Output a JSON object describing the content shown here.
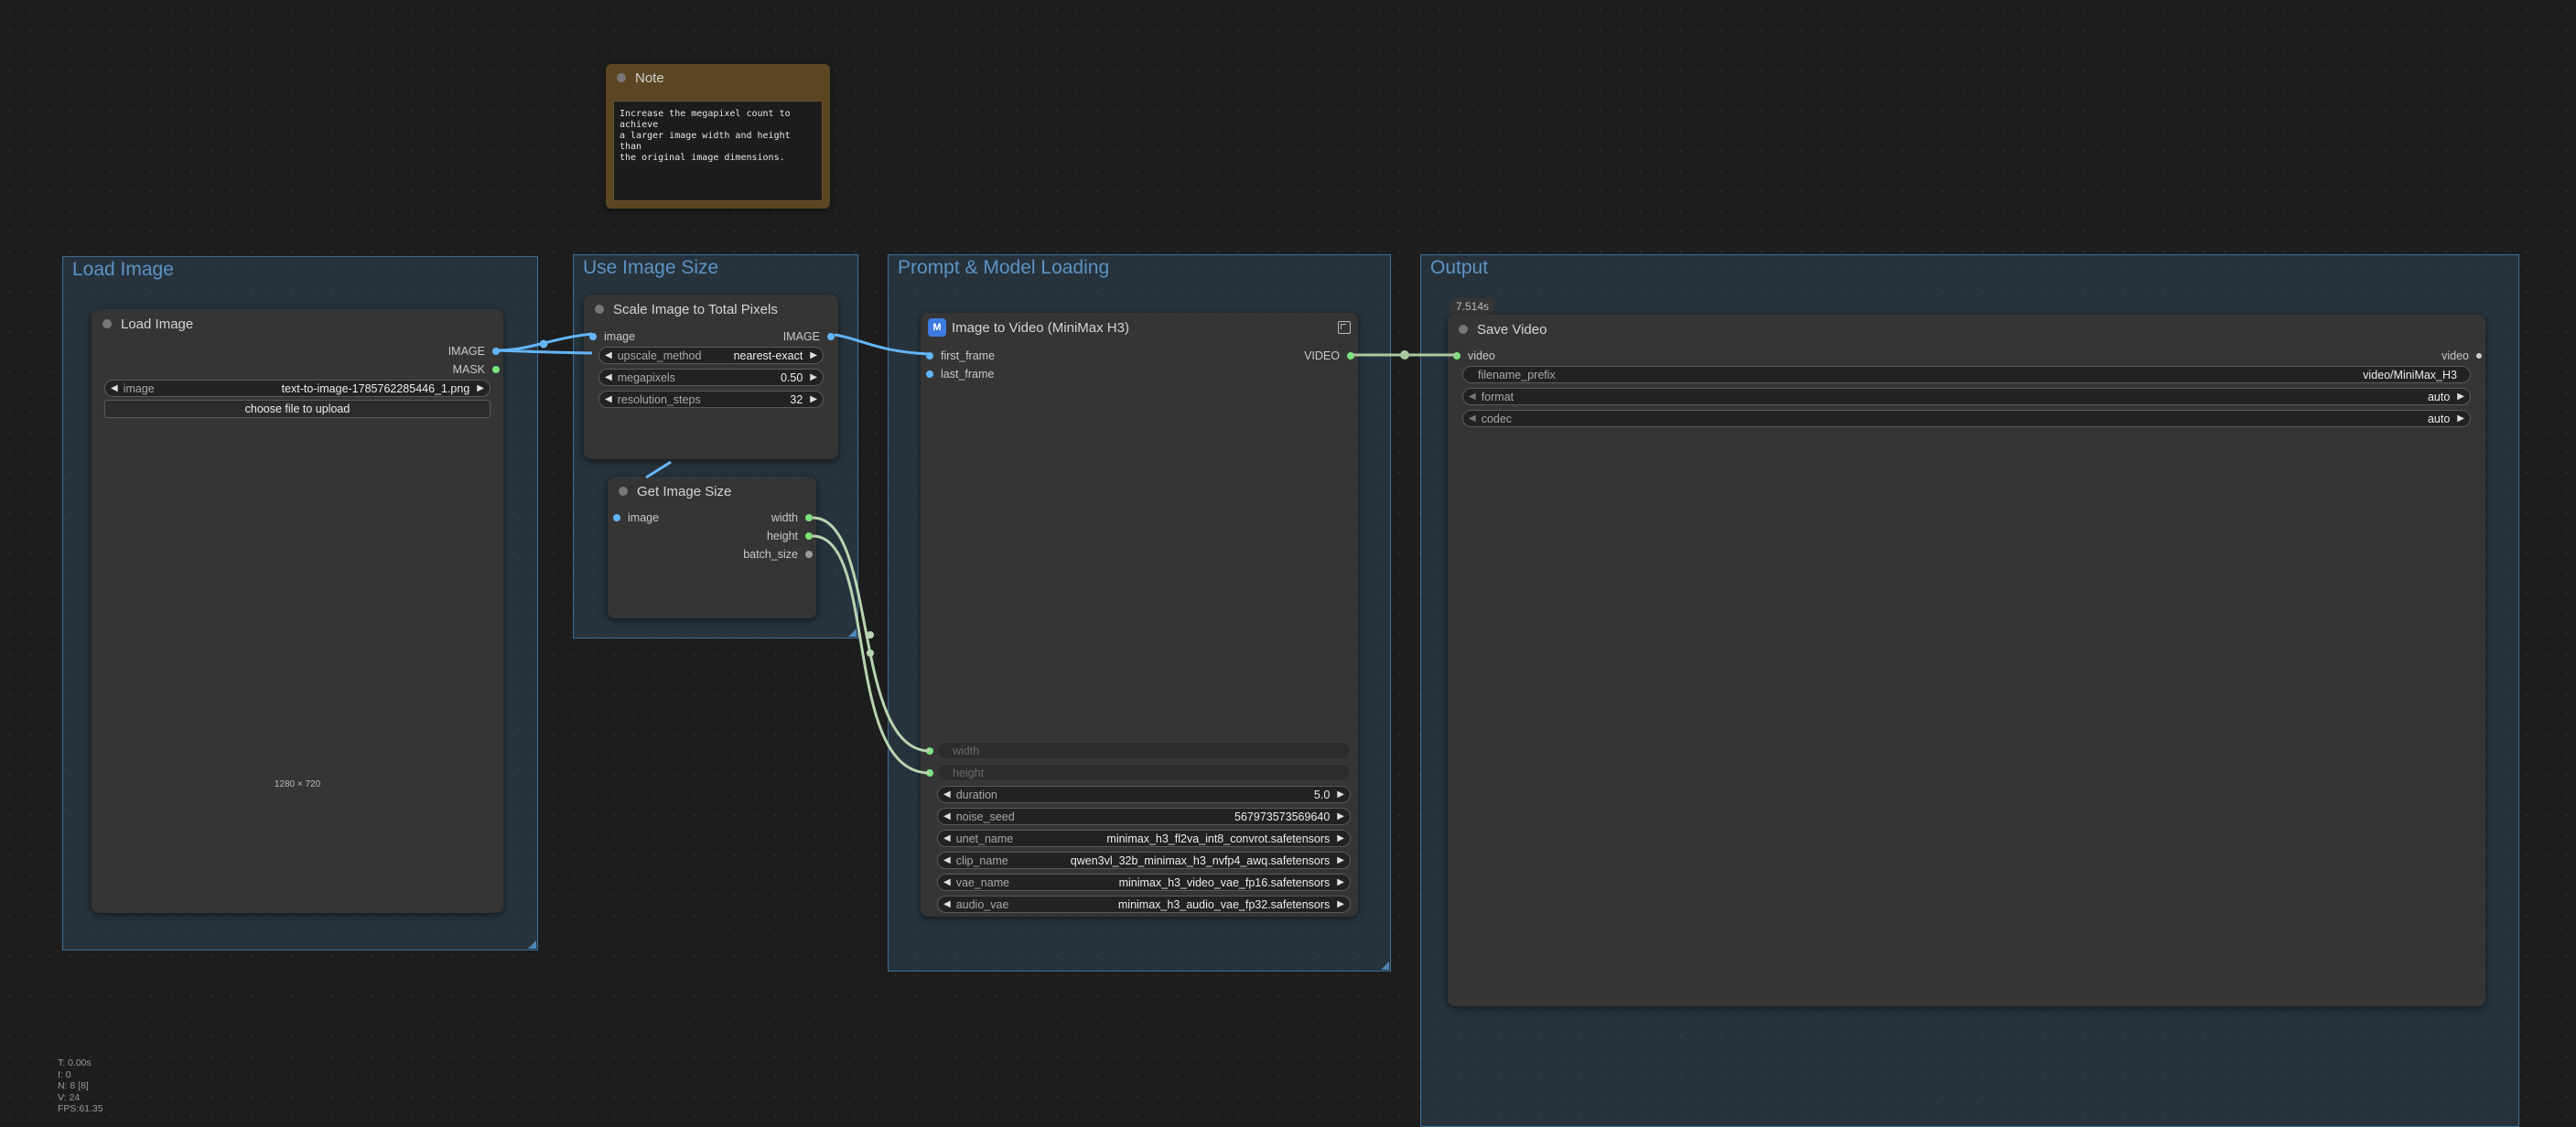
{
  "groups": {
    "load_image": "Load Image",
    "use_image_size": "Use Image Size",
    "prompt_model": "Prompt & Model Loading",
    "output": "Output"
  },
  "note": {
    "title": "Note",
    "text": "Increase the megapixel count to achieve\na larger image width and height than\nthe original image dimensions."
  },
  "load_image_node": {
    "title": "Load Image",
    "outputs": [
      "IMAGE",
      "MASK"
    ],
    "image_label": "image",
    "image_value": "text-to-image-1785762285446_1.png",
    "upload_label": "choose file to upload",
    "dimensions": "1280 × 720"
  },
  "scale_node": {
    "title": "Scale Image to Total Pixels",
    "input": "image",
    "output": "IMAGE",
    "widgets": [
      {
        "label": "upscale_method",
        "value": "nearest-exact"
      },
      {
        "label": "megapixels",
        "value": "0.50"
      },
      {
        "label": "resolution_steps",
        "value": "32"
      }
    ]
  },
  "get_size_node": {
    "title": "Get Image Size",
    "input": "image",
    "outputs": [
      "width",
      "height",
      "batch_size"
    ]
  },
  "i2v_node": {
    "title": "Image to Video (MiniMax H3)",
    "inputs": [
      "first_frame",
      "last_frame"
    ],
    "output": "VIDEO",
    "converted": [
      "width",
      "height"
    ],
    "widgets": [
      {
        "label": "duration",
        "value": "5.0"
      },
      {
        "label": "noise_seed",
        "value": "567973573569640"
      },
      {
        "label": "unet_name",
        "value": "minimax_h3_fl2va_int8_convrot.safetensors"
      },
      {
        "label": "clip_name",
        "value": "qwen3vl_32b_minimax_h3_nvfp4_awq.safetensors"
      },
      {
        "label": "vae_name",
        "value": "minimax_h3_video_vae_fp16.safetensors"
      },
      {
        "label": "audio_vae",
        "value": "minimax_h3_audio_vae_fp32.safetensors"
      }
    ]
  },
  "save_node": {
    "badge": "7.514s",
    "title": "Save Video",
    "input": "video",
    "output": "video",
    "widgets": [
      {
        "label": "filename_prefix",
        "value": "video/MiniMax_H3"
      },
      {
        "label": "format",
        "value": "auto"
      },
      {
        "label": "codec",
        "value": "auto"
      }
    ]
  },
  "stats": [
    "T: 0.00s",
    "I: 0",
    "N: 8 [8]",
    "V: 24",
    "FPS:61.35"
  ],
  "colors": {
    "image_link": "#64b5f6",
    "int_link": "#b8d4b0",
    "video_link": "#a8c8a0"
  }
}
